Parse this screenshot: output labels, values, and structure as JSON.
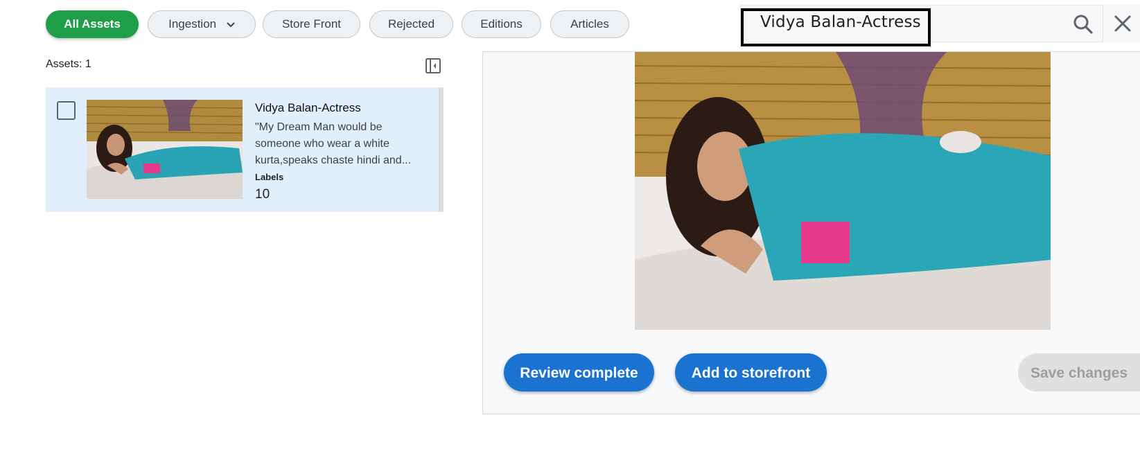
{
  "filters": {
    "chips": [
      {
        "label": "All Assets",
        "active": true
      },
      {
        "label": "Ingestion",
        "has_dropdown": true
      },
      {
        "label": "Store Front"
      },
      {
        "label": "Rejected"
      },
      {
        "label": "Editions"
      },
      {
        "label": "Articles"
      }
    ]
  },
  "search": {
    "value": "Vidya Balan-Actress",
    "icon": "search-icon",
    "close_icon": "close-icon"
  },
  "list": {
    "count_label": "Assets: 1",
    "collapse_icon": "collapse-panel-icon",
    "items": [
      {
        "title": "Vidya Balan-Actress",
        "description": "\"My Dream Man would be someone who wear a white kurta,speaks chaste hindi and...",
        "labels_heading": "Labels",
        "labels_count": "10"
      }
    ]
  },
  "detail": {
    "review_button": "Review complete",
    "storefront_button": "Add to storefront",
    "save_button": "Save changes"
  },
  "colors": {
    "accent_green": "#1e9e48",
    "primary_blue": "#1a73d1",
    "selected_row": "#e1effd"
  }
}
